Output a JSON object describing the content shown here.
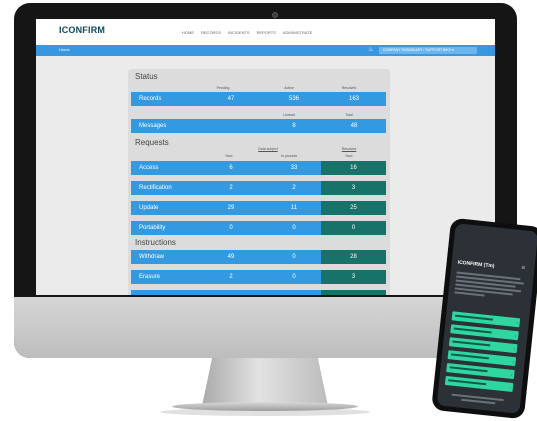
{
  "app": {
    "logo": "ICONFIRM",
    "nav": [
      "HOME",
      "RECORDS",
      "INCIDENTS",
      "REPORTS",
      "ADMINISTRATE"
    ],
    "breadcrumb": "Home",
    "account_label": "COMPANY SUBSIDIARY / SUPPORT BIKE ▾"
  },
  "status": {
    "title": "Status",
    "records_headers": [
      "Pending",
      "Active",
      "Resolved"
    ],
    "records": {
      "label": "Records",
      "values": [
        "47",
        "536",
        "163"
      ]
    },
    "messages_headers": [
      "Unread",
      "Total"
    ],
    "messages": {
      "label": "Messages",
      "values": [
        "8",
        "48"
      ]
    }
  },
  "requests": {
    "title": "Requests",
    "group_headers": [
      "Data subject",
      "Resolved"
    ],
    "sub_headers": [
      "New",
      "In process",
      "Now"
    ],
    "rows": [
      {
        "label": "Access",
        "values": [
          "6",
          "33",
          "16"
        ]
      },
      {
        "label": "Rectification",
        "values": [
          "2",
          "2",
          "3"
        ]
      },
      {
        "label": "Update",
        "values": [
          "29",
          "11",
          "25"
        ]
      },
      {
        "label": "Portability",
        "values": [
          "0",
          "0",
          "0"
        ]
      }
    ]
  },
  "instructions": {
    "title": "Instructions",
    "rows": [
      {
        "label": "Withdraw",
        "values": [
          "49",
          "0",
          "28"
        ]
      },
      {
        "label": "Erasure",
        "values": [
          "2",
          "0",
          "3"
        ]
      }
    ]
  },
  "phone": {
    "logo": "ICONFIRM (Tm)",
    "menu_icon": "hamburger-icon",
    "buttons": 6
  },
  "colors": {
    "row_blue": "#3399e1",
    "teal": "#17726a",
    "nav_blue": "#3798e0",
    "phone_green": "#2fd6a0"
  }
}
